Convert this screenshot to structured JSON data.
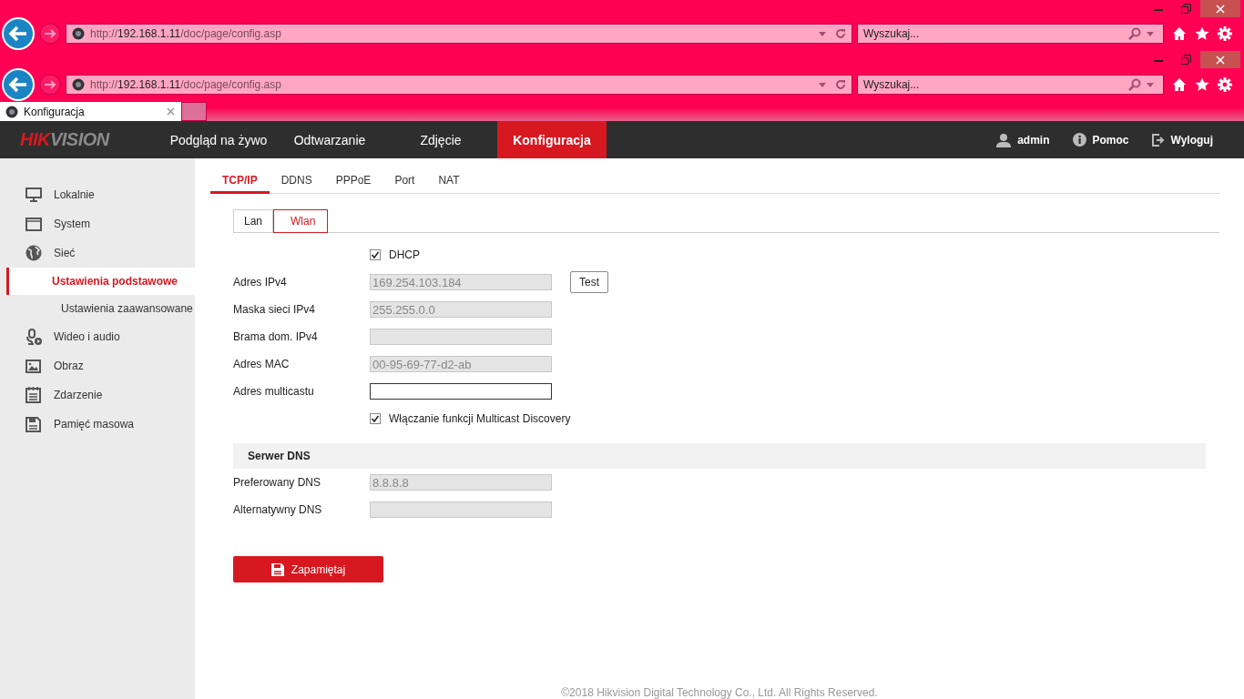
{
  "browser_bars": [
    {
      "url": {
        "scheme": "http://",
        "host": "192.168.1.11",
        "path": "/doc/page/config.asp"
      },
      "search_placeholder": "Wyszukaj..."
    },
    {
      "url": {
        "scheme": "http://",
        "host": "192.168.1.11",
        "path": "/doc/page/config.asp"
      },
      "search_placeholder": "Wyszukaj..."
    }
  ],
  "browser_tab": {
    "title": "Konfiguracja"
  },
  "logo": {
    "accent": "HIK",
    "rest": "VISION"
  },
  "nav": [
    {
      "label": "Podgląd na żywo",
      "selected": false
    },
    {
      "label": "Odtwarzanie",
      "selected": false
    },
    {
      "label": "Zdjęcie",
      "selected": false
    },
    {
      "label": "Konfiguracja",
      "selected": true
    }
  ],
  "user_menu": [
    {
      "kind": "user",
      "label": "admin"
    },
    {
      "kind": "help",
      "label": "Pomoc"
    },
    {
      "kind": "logout",
      "label": "Wyloguj"
    }
  ],
  "sidebar": {
    "items": [
      {
        "kind": "monitor",
        "label": "Lokalnie",
        "selected": false
      },
      {
        "kind": "window",
        "label": "System",
        "selected": false
      },
      {
        "kind": "globe",
        "label": "Sieć",
        "selected": false,
        "children": [
          {
            "label": "Ustawienia podstawowe",
            "selected": true
          },
          {
            "label": "Ustawienia zaawansowane",
            "selected": false
          }
        ]
      },
      {
        "kind": "mic",
        "label": "Wideo i audio",
        "selected": false
      },
      {
        "kind": "image",
        "label": "Obraz",
        "selected": false
      },
      {
        "kind": "list",
        "label": "Zdarzenie",
        "selected": false
      },
      {
        "kind": "disk",
        "label": "Pamięć masowa",
        "selected": false
      }
    ]
  },
  "tabs": [
    {
      "label": "TCP/IP",
      "selected": true
    },
    {
      "label": "DDNS",
      "selected": false
    },
    {
      "label": "PPPoE",
      "selected": false
    },
    {
      "label": "Port",
      "selected": false
    },
    {
      "label": "NAT",
      "selected": false
    }
  ],
  "subtabs": [
    {
      "label": "Lan",
      "selected": false
    },
    {
      "label": "Wlan",
      "selected": true
    }
  ],
  "form": [
    {
      "kind": "checkbox",
      "label": "DHCP",
      "checked": true
    },
    {
      "kind": "field",
      "label": "Adres IPv4",
      "value": "169.254.103.184",
      "disabled": true,
      "button": "Test"
    },
    {
      "kind": "field",
      "label": "Maska sieci IPv4",
      "value": "255.255.0.0",
      "disabled": true
    },
    {
      "kind": "field",
      "label": "Brama dom. IPv4",
      "disabled": true
    },
    {
      "kind": "field",
      "label": "Adres MAC",
      "value": "00-95-69-77-d2-ab",
      "disabled": true
    },
    {
      "kind": "field",
      "label": "Adres multicastu",
      "disabled": false
    },
    {
      "kind": "checkbox",
      "label": "Włączanie funkcji Multicast Discovery",
      "checked": true
    }
  ],
  "dns_section": {
    "title": "Serwer DNS",
    "fields": [
      {
        "kind": "field",
        "label": "Preferowany DNS",
        "value": "8.8.8.8",
        "disabled": true
      },
      {
        "kind": "field",
        "label": "Alternatywny DNS",
        "disabled": true
      }
    ]
  },
  "save_button": "Zapamiętaj",
  "footer": "©2018 Hikvision Digital Technology Co., Ltd. All Rights Reserved."
}
